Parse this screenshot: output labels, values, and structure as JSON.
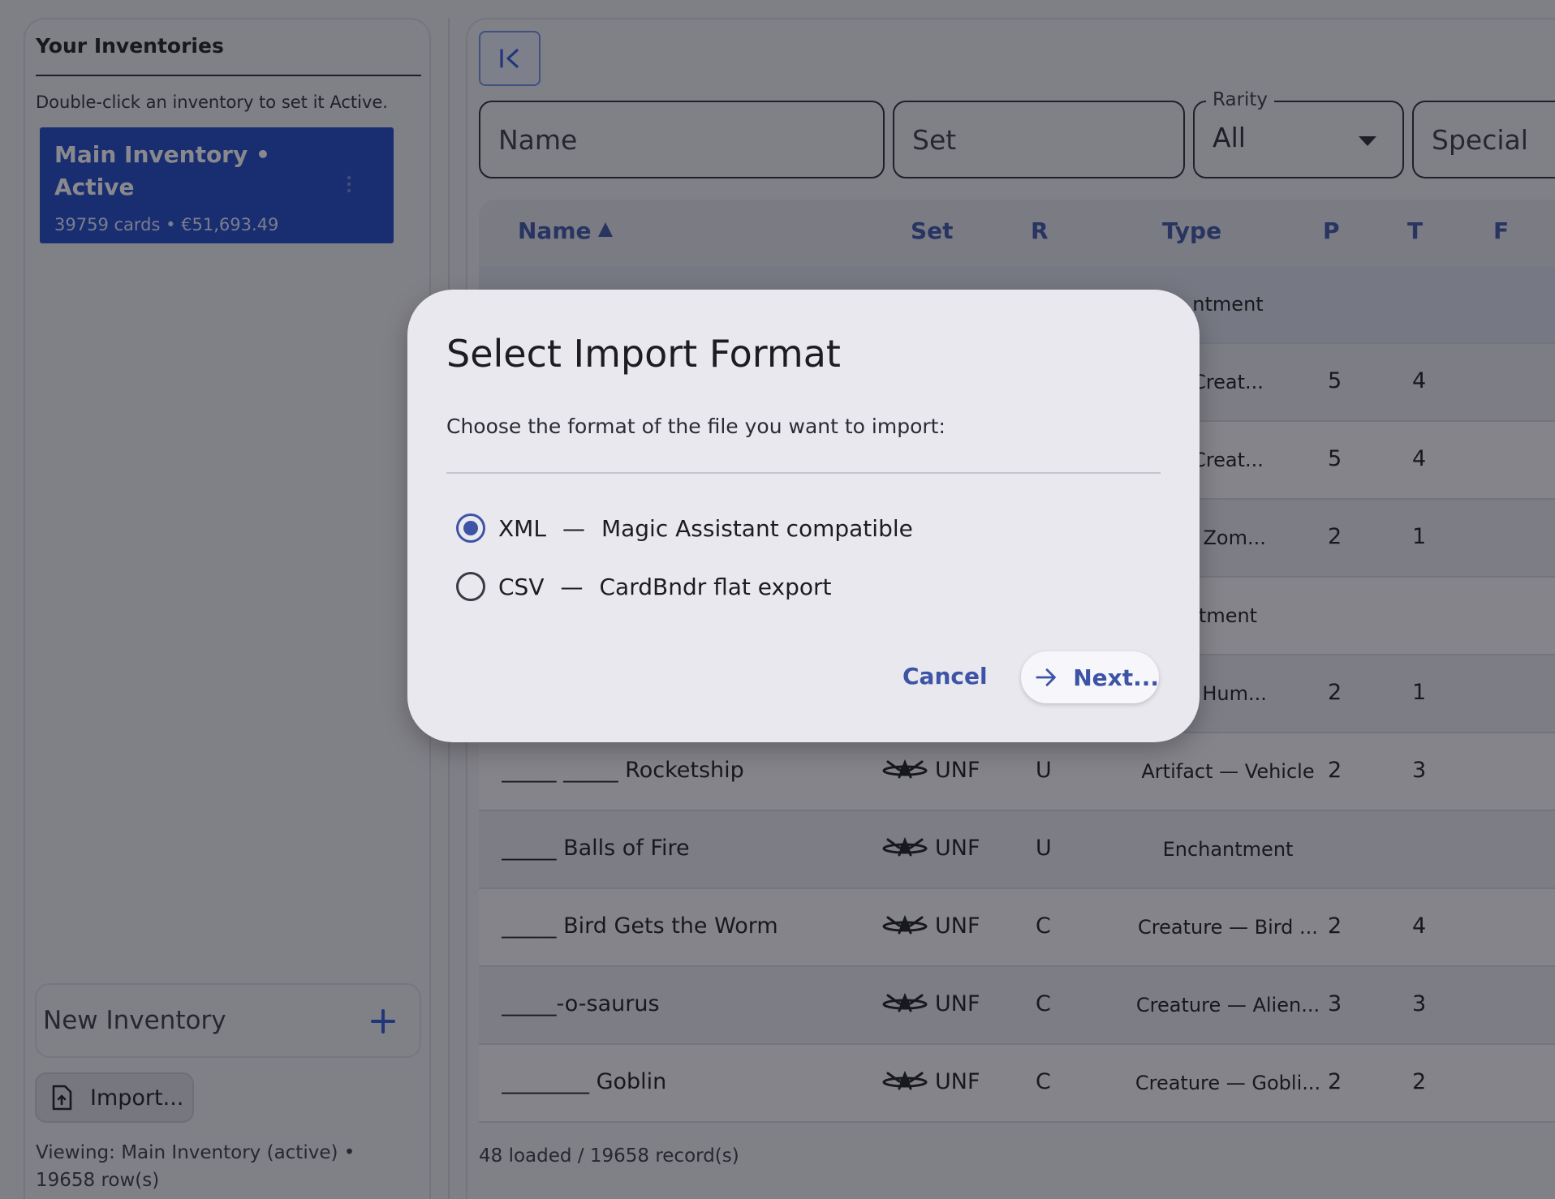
{
  "sidebar": {
    "title": "Your Inventories",
    "hint": "Double-click an inventory to set it Active.",
    "active_inventory": {
      "name": "Main Inventory • Active",
      "meta": "39759 cards • €51,693.49"
    },
    "new_inventory_placeholder": "New Inventory",
    "import_label": "Import...",
    "viewing": "Viewing: Main Inventory (active) • 19658 row(s)"
  },
  "filters": {
    "name_placeholder": "Name",
    "set_placeholder": "Set",
    "rarity_label": "Rarity",
    "rarity_value": "All",
    "special_placeholder": "Special"
  },
  "table": {
    "headers": {
      "name": "Name",
      "set": "Set",
      "r": "R",
      "type": "Type",
      "p": "P",
      "t": "T",
      "f": "F"
    },
    "rows": [
      {
        "name": "",
        "set": "",
        "r": "",
        "type": "ntment",
        "p": "",
        "t": ""
      },
      {
        "name": "",
        "set": "",
        "r": "",
        "type": "Creat...",
        "p": "5",
        "t": "4"
      },
      {
        "name": "",
        "set": "",
        "r": "",
        "type": "Creat...",
        "p": "5",
        "t": "4"
      },
      {
        "name": "",
        "set": "",
        "r": "",
        "type": "- Zom...",
        "p": "2",
        "t": "1"
      },
      {
        "name": "",
        "set": "",
        "r": "",
        "type": "tment",
        "p": "",
        "t": ""
      },
      {
        "name": "",
        "set": "",
        "r": "",
        "type": "- Hum...",
        "p": "2",
        "t": "1"
      },
      {
        "name": "_____ _____ Rocketship",
        "set": "UNF",
        "r": "U",
        "type": "Artifact — Vehicle",
        "p": "2",
        "t": "3"
      },
      {
        "name": "_____ Balls of Fire",
        "set": "UNF",
        "r": "U",
        "type": "Enchantment",
        "p": "",
        "t": ""
      },
      {
        "name": "_____ Bird Gets the Worm",
        "set": "UNF",
        "r": "C",
        "type": "Creature — Bird ...",
        "p": "2",
        "t": "4"
      },
      {
        "name": "_____-o-saurus",
        "set": "UNF",
        "r": "C",
        "type": "Creature — Alien...",
        "p": "3",
        "t": "3"
      },
      {
        "name": "________ Goblin",
        "set": "UNF",
        "r": "C",
        "type": "Creature — Gobli...",
        "p": "2",
        "t": "2"
      }
    ]
  },
  "footer": {
    "count": "48 loaded / 19658 record(s)"
  },
  "dialog": {
    "title": "Select Import Format",
    "description": "Choose the format of the file you want to import:",
    "options": [
      {
        "key": "XML",
        "desc": "Magic Assistant compatible",
        "selected": true
      },
      {
        "key": "CSV",
        "desc": "CardBndr flat export",
        "selected": false
      }
    ],
    "dash": "—",
    "cancel_label": "Cancel",
    "next_label": "Next..."
  },
  "colors": {
    "accent": "#3d54a6",
    "active_inventory": "#1e47c6",
    "scrim": "rgba(20,20,28,0.5)"
  }
}
